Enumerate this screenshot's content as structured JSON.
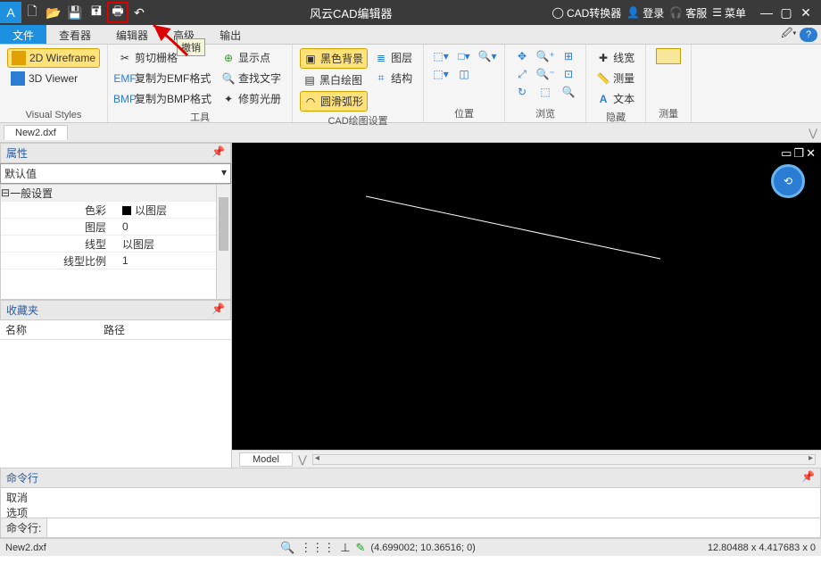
{
  "app": {
    "title": "风云CAD编辑器"
  },
  "titlebar_right": {
    "converter": "CAD转换器",
    "login": "登录",
    "support": "客服",
    "menu": "菜单"
  },
  "tabs": {
    "file": "文件",
    "viewer": "查看器",
    "editor": "编辑器",
    "advanced": "高级",
    "output": "输出",
    "tooltip": "撤销"
  },
  "ribbon": {
    "visual_styles": {
      "wireframe2d": "2D Wireframe",
      "viewer3d": "3D Viewer",
      "label": "Visual Styles"
    },
    "tools": {
      "cut": "剪切栅格",
      "copy_emf": "复制为EMF格式",
      "copy_bmp": "复制为BMP格式",
      "show_point": "显示点",
      "find_text": "查找文字",
      "trim_aura": "修剪光册",
      "label": "工具"
    },
    "cad_settings": {
      "black_bg": "黑色背景",
      "bw_draw": "黑白绘图",
      "smooth_arc": "圆滑弧形",
      "layers": "图层",
      "structure": "结构",
      "label": "CAD绘图设置"
    },
    "position": {
      "label": "位置"
    },
    "browse": {
      "label": "浏览"
    },
    "hide": {
      "linewidth": "线宽",
      "measure_sm": "测量",
      "text": "文本",
      "label": "隐藏"
    },
    "measure": {
      "big": "测量"
    }
  },
  "document": {
    "tab": "New2.dxf"
  },
  "properties": {
    "title": "属性",
    "combo": "默认值",
    "group_general": "一般设置",
    "rows": {
      "color_k": "色彩",
      "color_v": "以图层",
      "layer_k": "图层",
      "layer_v": "0",
      "linetype_k": "线型",
      "linetype_v": "以图层",
      "ltscale_k": "线型比例",
      "ltscale_v": "1"
    }
  },
  "favorites": {
    "title": "收藏夹",
    "col_name": "名称",
    "col_path": "路径"
  },
  "viewport": {
    "model_tab": "Model"
  },
  "command": {
    "title": "命令行",
    "log1": "取消",
    "log2": "选项",
    "prompt": "命令行:"
  },
  "status": {
    "file": "New2.dxf",
    "coords": "(4.699002; 10.36516; 0)",
    "dims": "12.80488 x 4.417683 x 0"
  }
}
